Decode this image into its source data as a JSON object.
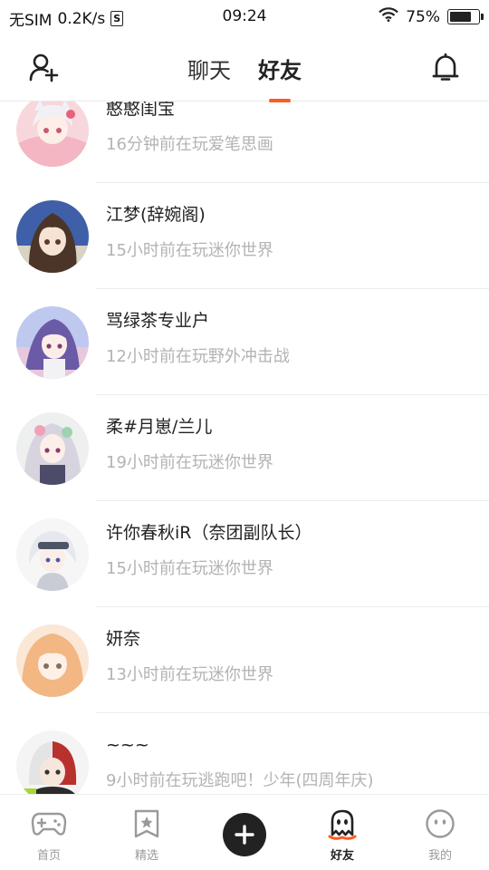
{
  "status_bar": {
    "carrier": "无SIM",
    "speed": "0.2K/s",
    "time": "09:24",
    "battery": "75%",
    "battery_level": 0.75
  },
  "header": {
    "add_friend_icon": "add-user-icon",
    "bell_icon": "bell-icon",
    "tabs": [
      {
        "label": "聊天",
        "active": false
      },
      {
        "label": "好友",
        "active": true
      }
    ],
    "accent_color": "#ff5a1f"
  },
  "friends": [
    {
      "name": "憨憨闺宝",
      "status": "16分钟前在玩爱笔思画"
    },
    {
      "name": "江梦(辞婉阁)",
      "status": "15小时前在玩迷你世界"
    },
    {
      "name": "骂绿茶专业户",
      "status": "12小时前在玩野外冲击战"
    },
    {
      "name": "柔#月崽/兰儿",
      "status": "19小时前在玩迷你世界"
    },
    {
      "name": "许你春秋iR（奈团副队长）",
      "status": "15小时前在玩迷你世界"
    },
    {
      "name": "妍奈",
      "status": "13小时前在玩迷你世界"
    },
    {
      "name": "~~~",
      "status": "9小时前在玩逃跑吧！少年(四周年庆)"
    }
  ],
  "bottom_nav": {
    "items": [
      {
        "label": "首页",
        "icon": "gamepad-icon",
        "active": false
      },
      {
        "label": "精选",
        "icon": "star-bookmark-icon",
        "active": false
      },
      {
        "label": "好友",
        "icon": "ghost-icon",
        "active": true
      },
      {
        "label": "我的",
        "icon": "face-icon",
        "active": false
      }
    ],
    "center_icon": "plus-icon"
  }
}
